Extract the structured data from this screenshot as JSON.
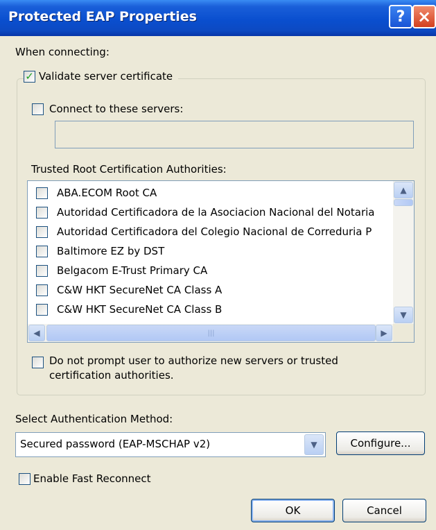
{
  "window": {
    "title": "Protected EAP Properties",
    "help_button": "?",
    "close_button": "×"
  },
  "dialog": {
    "when_connecting": "When connecting:",
    "validate_cert": {
      "label": "Validate server certificate",
      "checked": true
    },
    "connect_servers": {
      "label": "Connect to these servers:",
      "checked": false,
      "value": ""
    },
    "trusted_roots_label": "Trusted Root Certification Authorities:",
    "trusted_roots": [
      {
        "label": "ABA.ECOM Root CA",
        "checked": false
      },
      {
        "label": "Autoridad Certificadora de la Asociacion Nacional del Notaria",
        "checked": false
      },
      {
        "label": "Autoridad Certificadora del Colegio Nacional de Correduria P",
        "checked": false
      },
      {
        "label": "Baltimore EZ by DST",
        "checked": false
      },
      {
        "label": "Belgacom E-Trust Primary CA",
        "checked": false
      },
      {
        "label": "C&W HKT SecureNet CA Class A",
        "checked": false
      },
      {
        "label": "C&W HKT SecureNet CA Class B",
        "checked": false
      }
    ],
    "no_prompt": {
      "label_line1": "Do not prompt user to authorize new servers or trusted",
      "label_line2": "certification authorities.",
      "checked": false
    },
    "auth_method_label": "Select Authentication Method:",
    "auth_method_value": "Secured password (EAP-MSCHAP v2)",
    "configure_button": "Configure...",
    "fast_reconnect": {
      "label": "Enable Fast Reconnect",
      "checked": false
    },
    "ok_button": "OK",
    "cancel_button": "Cancel"
  },
  "colors": {
    "titlebar": "#0a4fcf",
    "dialog_bg": "#ece9d8",
    "check_mark": "#21a121"
  }
}
